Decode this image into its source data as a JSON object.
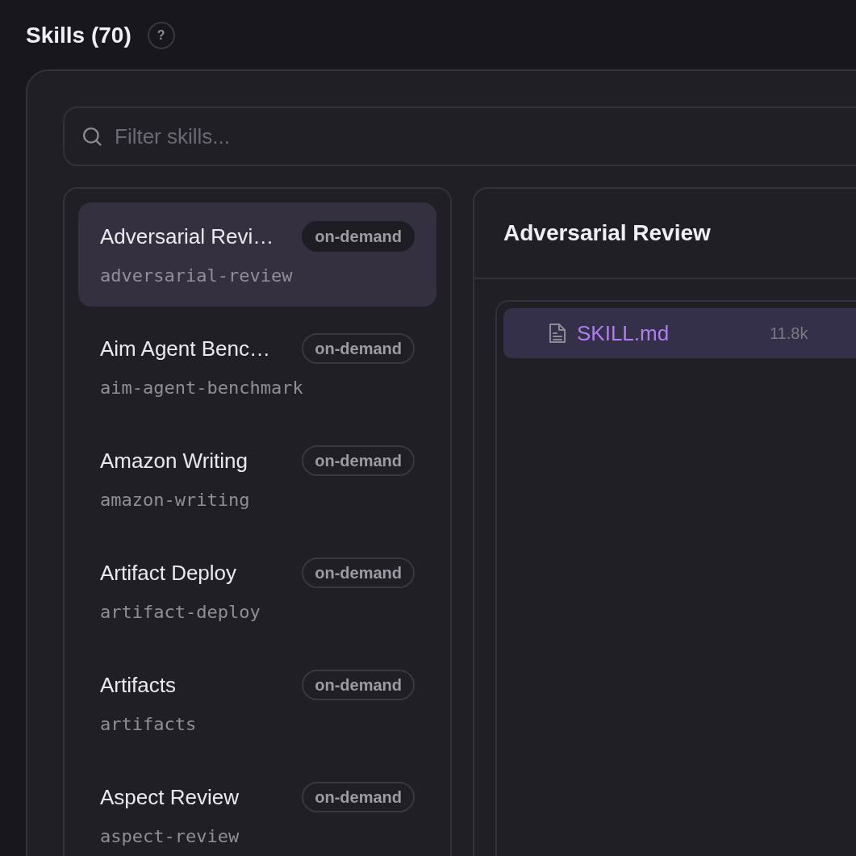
{
  "header": {
    "title": "Skills (70)",
    "help": "?"
  },
  "search": {
    "placeholder": "Filter skills..."
  },
  "skills": [
    {
      "name": "Adversarial Revi…",
      "slug": "adversarial-review",
      "badge": "on-demand",
      "selected": true
    },
    {
      "name": "Aim Agent Benc…",
      "slug": "aim-agent-benchmark",
      "badge": "on-demand",
      "selected": false
    },
    {
      "name": "Amazon Writing",
      "slug": "amazon-writing",
      "badge": "on-demand",
      "selected": false
    },
    {
      "name": "Artifact Deploy",
      "slug": "artifact-deploy",
      "badge": "on-demand",
      "selected": false
    },
    {
      "name": "Artifacts",
      "slug": "artifacts",
      "badge": "on-demand",
      "selected": false
    },
    {
      "name": "Aspect Review",
      "slug": "aspect-review",
      "badge": "on-demand",
      "selected": false
    }
  ],
  "detail": {
    "title": "Adversarial Review",
    "files": [
      {
        "name": "SKILL.md",
        "size": "11.8k",
        "selected": true
      }
    ]
  }
}
